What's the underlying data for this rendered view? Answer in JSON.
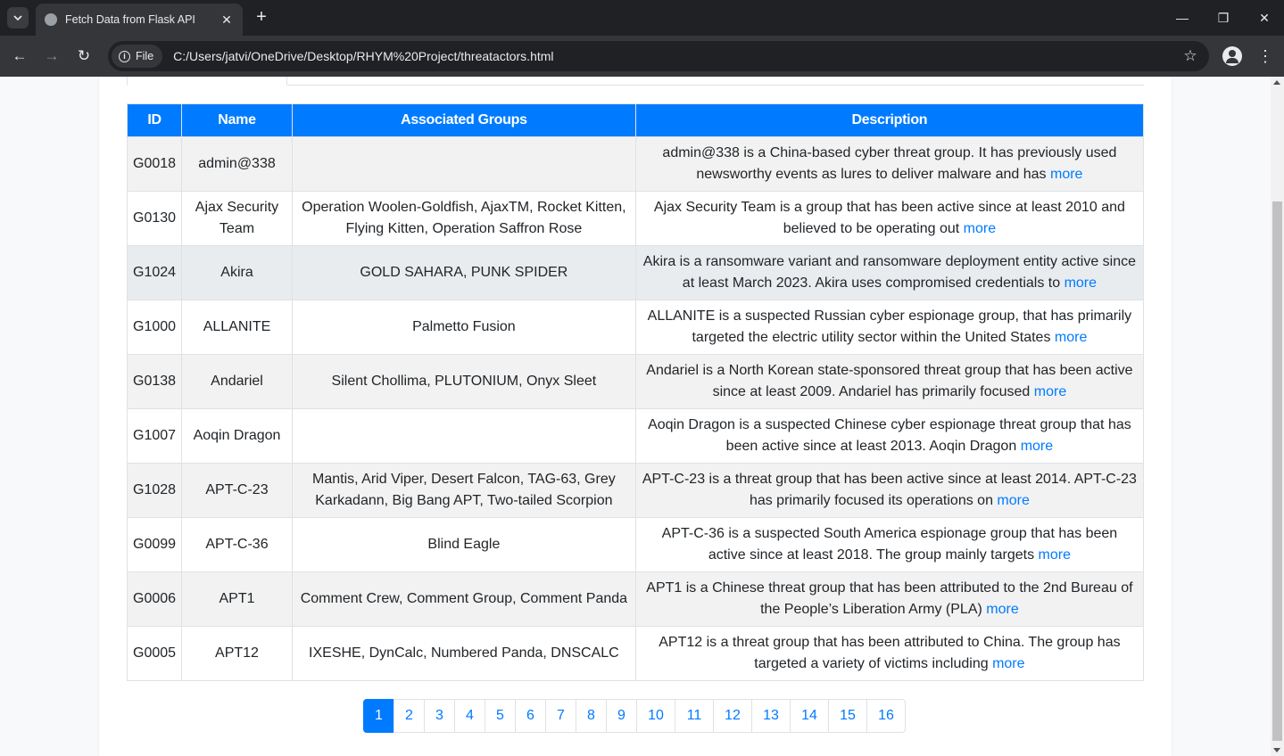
{
  "browser": {
    "tab_title": "Fetch Data from Flask API",
    "chip_label": "File",
    "url": "C:/Users/jatvi/OneDrive/Desktop/RHYM%20Project/threatactors.html"
  },
  "table": {
    "headers": [
      "ID",
      "Name",
      "Associated Groups",
      "Description"
    ],
    "more_label": "more",
    "rows": [
      {
        "id": "G0018",
        "name": "admin@338",
        "groups": "",
        "desc": "admin@338 is a China-based cyber threat group. It has previously used newsworthy events as lures to deliver malware and has"
      },
      {
        "id": "G0130",
        "name": "Ajax Security Team",
        "groups": "Operation Woolen-Goldfish, AjaxTM, Rocket Kitten, Flying Kitten, Operation Saffron Rose",
        "desc": "Ajax Security Team is a group that has been active since at least 2010 and believed to be operating out"
      },
      {
        "id": "G1024",
        "name": "Akira",
        "groups": "GOLD SAHARA, PUNK SPIDER",
        "desc": "Akira is a ransomware variant and ransomware deployment entity active since at least March 2023. Akira uses compromised credentials to"
      },
      {
        "id": "G1000",
        "name": "ALLANITE",
        "groups": "Palmetto Fusion",
        "desc": "ALLANITE is a suspected Russian cyber espionage group, that has primarily targeted the electric utility sector within the United States"
      },
      {
        "id": "G0138",
        "name": "Andariel",
        "groups": "Silent Chollima, PLUTONIUM, Onyx Sleet",
        "desc": "Andariel is a North Korean state-sponsored threat group that has been active since at least 2009. Andariel has primarily focused"
      },
      {
        "id": "G1007",
        "name": "Aoqin Dragon",
        "groups": "",
        "desc": "Aoqin Dragon is a suspected Chinese cyber espionage threat group that has been active since at least 2013. Aoqin Dragon"
      },
      {
        "id": "G1028",
        "name": "APT-C-23",
        "groups": "Mantis, Arid Viper, Desert Falcon, TAG-63, Grey Karkadann, Big Bang APT, Two-tailed Scorpion",
        "desc": "APT-C-23 is a threat group that has been active since at least 2014. APT-C-23 has primarily focused its operations on"
      },
      {
        "id": "G0099",
        "name": "APT-C-36",
        "groups": "Blind Eagle",
        "desc": "APT-C-36 is a suspected South America espionage group that has been active since at least 2018. The group mainly targets"
      },
      {
        "id": "G0006",
        "name": "APT1",
        "groups": "Comment Crew, Comment Group, Comment Panda",
        "desc": "APT1 is a Chinese threat group that has been attributed to the 2nd Bureau of the People’s Liberation Army (PLA)"
      },
      {
        "id": "G0005",
        "name": "APT12",
        "groups": "IXESHE, DynCalc, Numbered Panda, DNSCALC",
        "desc": "APT12 is a threat group that has been attributed to China. The group has targeted a variety of victims including"
      }
    ]
  },
  "pagination": {
    "pages": [
      "1",
      "2",
      "3",
      "4",
      "5",
      "6",
      "7",
      "8",
      "9",
      "10",
      "11",
      "12",
      "13",
      "14",
      "15",
      "16"
    ],
    "active": "1"
  },
  "colors": {
    "header_bg": "#007bff",
    "link": "#007bff"
  }
}
